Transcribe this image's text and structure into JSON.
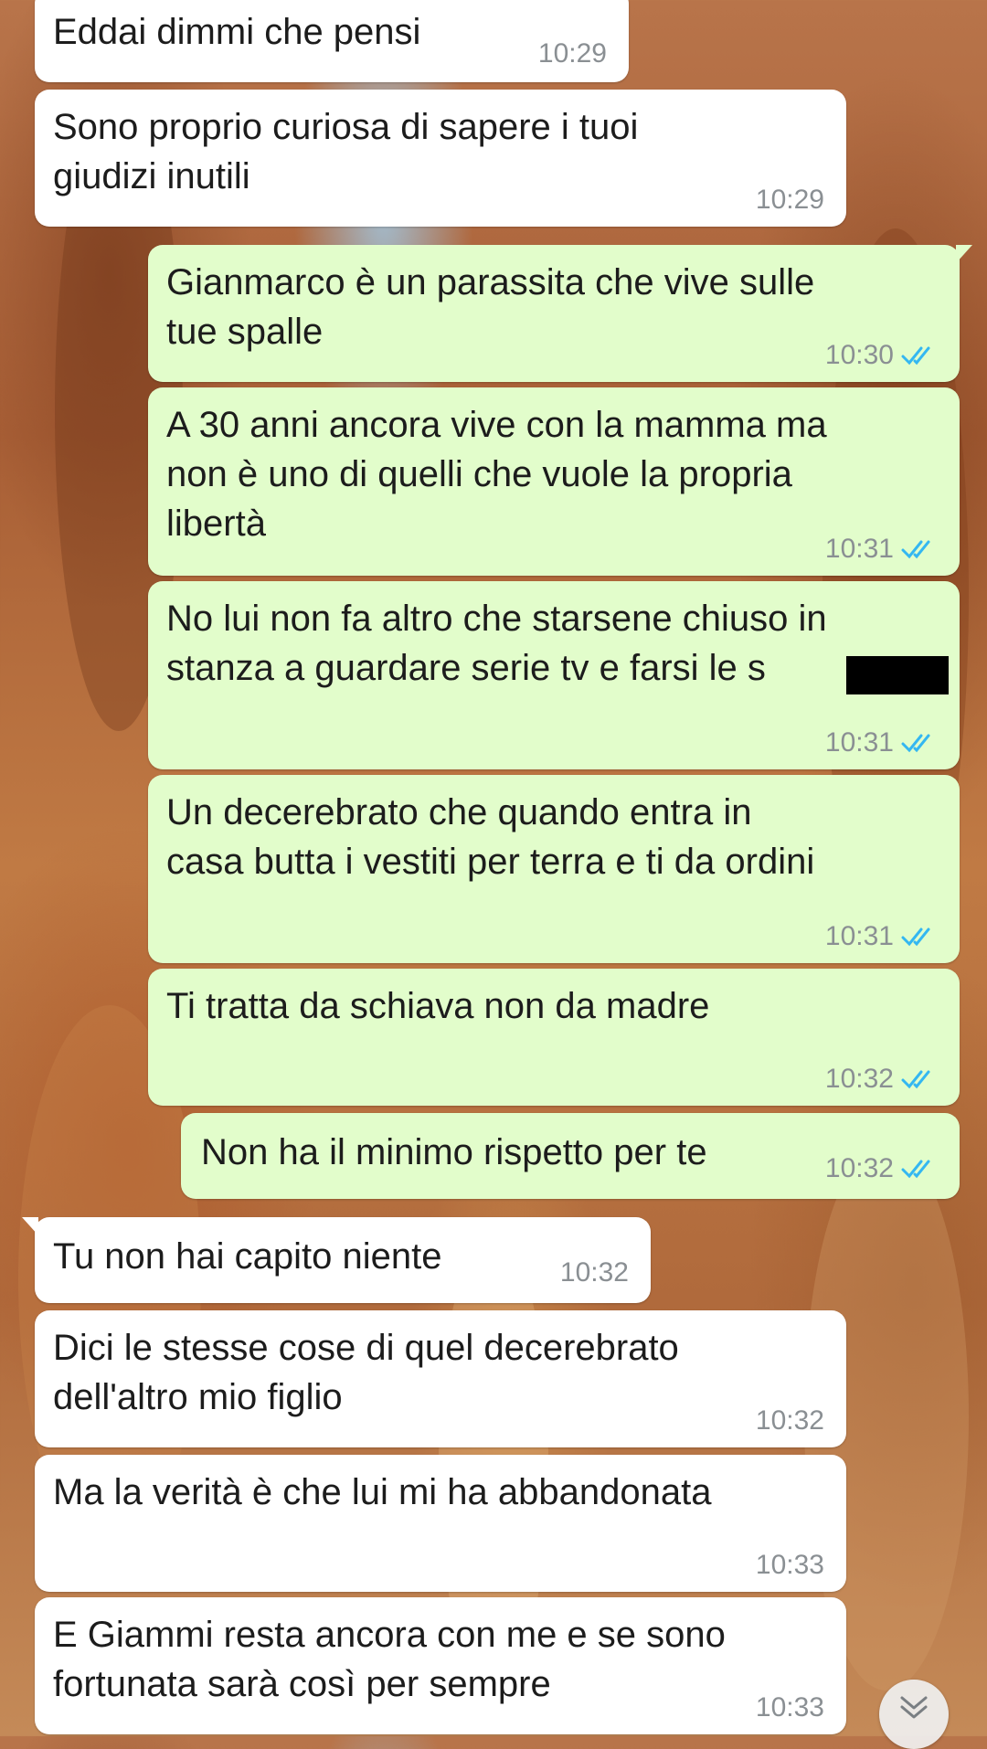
{
  "colors": {
    "incoming_bubble": "#ffffff",
    "outgoing_bubble": "#e2fdcb",
    "read_ticks": "#34b7f1",
    "time_text": "#8a8f93"
  },
  "messages": [
    {
      "text": "Eddai dimmi che pensi",
      "time": "10:29",
      "direction": "incoming"
    },
    {
      "text": "Sono proprio curiosa di sapere i tuoi\ngiudizi inutili",
      "time": "10:29",
      "direction": "incoming"
    },
    {
      "text": "Gianmarco è un parassita che vive sulle\ntue spalle",
      "time": "10:30",
      "direction": "outgoing",
      "status_icon": "double-check-icon"
    },
    {
      "text": "A 30 anni ancora vive con la mamma ma\nnon è uno di quelli che vuole la propria\nlibertà",
      "time": "10:31",
      "direction": "outgoing",
      "status_icon": "double-check-icon"
    },
    {
      "text": "No lui non fa altro che starsene chiuso in\nstanza a guardare serie tv e farsi le s",
      "time": "10:31",
      "direction": "outgoing",
      "status_icon": "double-check-icon"
    },
    {
      "text": "Un decerebrato che quando entra in\ncasa butta i vestiti per terra e ti da ordini",
      "time": "10:31",
      "direction": "outgoing",
      "status_icon": "double-check-icon"
    },
    {
      "text": "Ti tratta da schiava non da madre",
      "time": "10:32",
      "direction": "outgoing",
      "status_icon": "double-check-icon"
    },
    {
      "text": "Non ha il minimo rispetto per te",
      "time": "10:32",
      "direction": "outgoing",
      "status_icon": "double-check-icon"
    },
    {
      "text": "Tu non hai capito niente",
      "time": "10:32",
      "direction": "incoming"
    },
    {
      "text": "Dici le stesse cose di quel decerebrato\ndell'altro mio figlio",
      "time": "10:32",
      "direction": "incoming"
    },
    {
      "text": "Ma la verità è che lui mi ha abbandonata",
      "time": "10:33",
      "direction": "incoming"
    },
    {
      "text": "E Giammi resta ancora con me e se sono\nfortunata sarà così per sempre",
      "time": "10:33",
      "direction": "incoming"
    }
  ],
  "scroll_button": {
    "icon": "double-chevron-down-icon"
  }
}
